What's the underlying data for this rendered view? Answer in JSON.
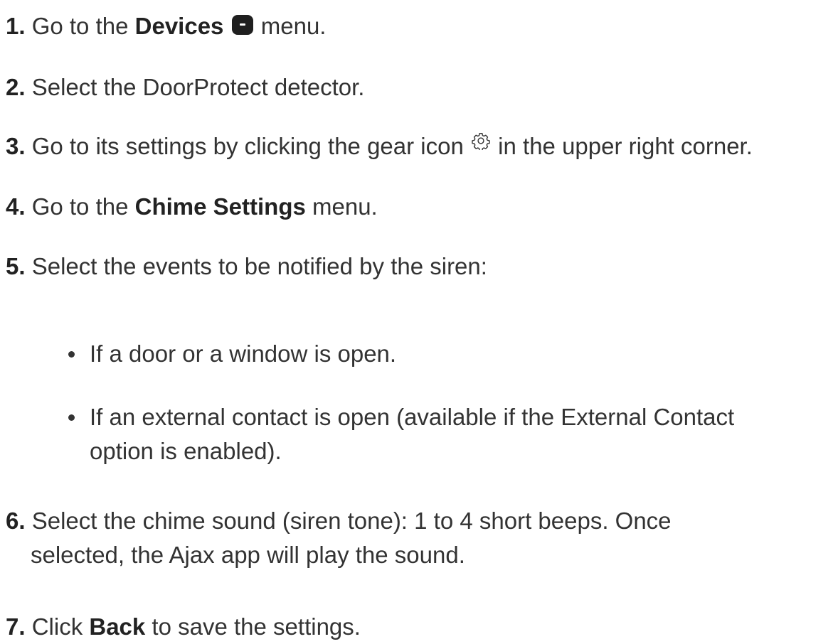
{
  "steps": [
    {
      "num": "1.",
      "pre": "Go to the ",
      "bold": "Devices",
      "post": " menu.",
      "icon": "devices-icon"
    },
    {
      "num": "2.",
      "text": "Select the DoorProtect detector."
    },
    {
      "num": "3.",
      "pre": "Go to its settings by clicking the gear icon ",
      "post": " in the upper right corner.",
      "icon": "gear-icon"
    },
    {
      "num": "4.",
      "pre": "Go to the ",
      "bold": "Chime Settings",
      "post": " menu."
    },
    {
      "num": "5.",
      "text": "Select the events to be notified by the siren:"
    },
    {
      "num": "6.",
      "line1": "Select the chime sound (siren tone): 1 to 4 short beeps. Once",
      "line2": "selected, the Ajax app will play the sound."
    },
    {
      "num": "7.",
      "pre": "Click ",
      "bold": "Back",
      "post": " to save the settings."
    }
  ],
  "bullets": [
    {
      "text": "If a door or a window is open."
    },
    {
      "line1": "If an external contact is open (available if the External Contact",
      "line2": "option is enabled)."
    }
  ]
}
